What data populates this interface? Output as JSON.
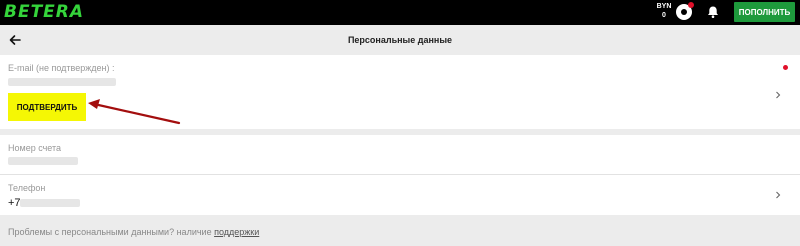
{
  "topbar": {
    "logo": "BETERA",
    "currency": "BYN",
    "balance": "0",
    "topup_label": "ПОПОЛНИТЬ",
    "accent": "#1e9a3c"
  },
  "header": {
    "title": "Персональные данные"
  },
  "email_section": {
    "label": "E-mail (не подтвержден) :",
    "verify_label": "ПОДТВЕРДИТЬ",
    "verify_color": "#f5f704"
  },
  "account_section": {
    "label": "Номер счета"
  },
  "phone_section": {
    "label": "Телефон",
    "prefix": "+7"
  },
  "footer": {
    "text": "Проблемы с персональными данными? наличие ",
    "link": "поддержки"
  }
}
